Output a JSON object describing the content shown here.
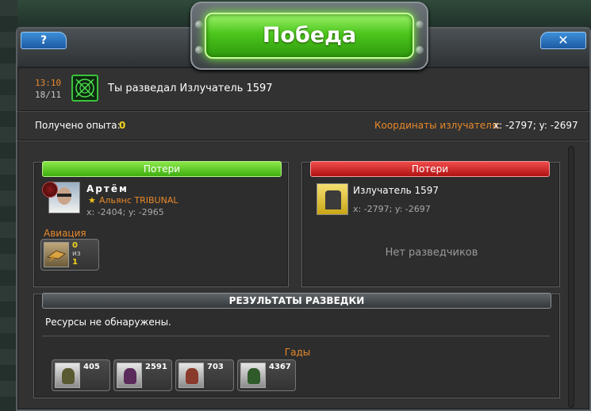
{
  "window": {
    "title": "Победа",
    "help_label": "?",
    "close_label": "✕"
  },
  "report": {
    "time": "13:10",
    "date": "18/11",
    "icon": "radar-icon",
    "title": "Ты разведал Излучатель 1597"
  },
  "experience": {
    "label": "Получено опыта:",
    "value": "0"
  },
  "emitter_coords": {
    "label": "Координаты излучателя:",
    "value": "x: -2797; y: -2697"
  },
  "attacker": {
    "header": "Потери",
    "header_color": "#4cc61c",
    "name": "Артём",
    "alliance": "Альянс TRIBUNAL",
    "coords": "x: -2404; y: -2965",
    "unit_type": "Авиация",
    "unit": {
      "icon": "aircraft-icon",
      "count": "0",
      "of_label": "из",
      "total": "1"
    }
  },
  "defender": {
    "header": "Потери",
    "header_color": "#c81c1c",
    "name": "Излучатель 1597",
    "coords": "x: -2797; y: -2697",
    "icon": "emitter-icon",
    "empty_text": "Нет разведчиков"
  },
  "results": {
    "header": "РЕЗУЛЬТАТЫ РАЗВЕДКИ",
    "no_resources": "Ресурсы не обнаружены.",
    "creatures_label": "Гады",
    "creatures": [
      {
        "count": "405",
        "icon": "creature-bug-icon",
        "color": "#5a5a32"
      },
      {
        "count": "2591",
        "icon": "creature-spider-icon",
        "color": "#5a2a5a"
      },
      {
        "count": "703",
        "icon": "creature-crab-icon",
        "color": "#8a3a2a"
      },
      {
        "count": "4367",
        "icon": "creature-mantis-icon",
        "color": "#2f5a2a"
      }
    ]
  }
}
